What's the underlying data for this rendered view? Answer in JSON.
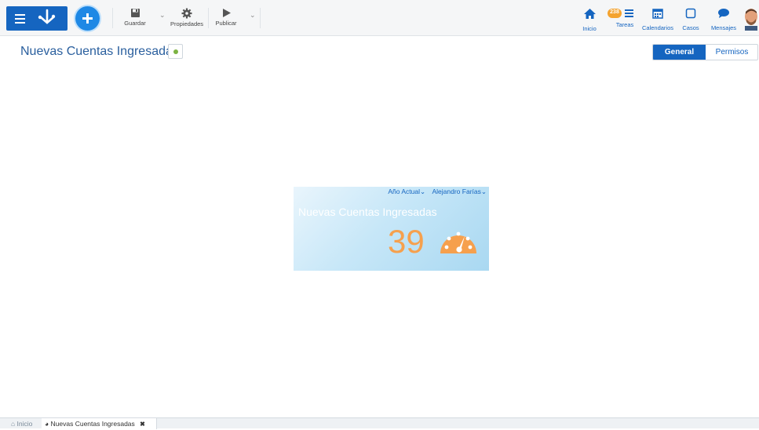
{
  "toolbar": {
    "save_label": "Guardar",
    "properties_label": "Propiedades",
    "publish_label": "Publicar"
  },
  "nav": {
    "home_label": "Inicio",
    "tasks_label": "Tareas",
    "tasks_count": "238",
    "calendars_label": "Calendarios",
    "cases_label": "Casos",
    "messages_label": "Mensajes"
  },
  "page": {
    "title": "Nuevas Cuentas Ingresadas",
    "tabs": {
      "general": "General",
      "permissions": "Permisos"
    }
  },
  "widget": {
    "filter_period": "Año Actual",
    "filter_user": "Alejandro Farías",
    "title": "Nuevas Cuentas Ingresadas",
    "value": "39"
  },
  "bottom_tabs": {
    "home": "Inicio",
    "current": "Nuevas Cuentas Ingresadas"
  },
  "colors": {
    "brand": "#1565c0",
    "accent_orange": "#f6a04d",
    "badge": "#f4a32f",
    "status_green": "#7cb342"
  }
}
